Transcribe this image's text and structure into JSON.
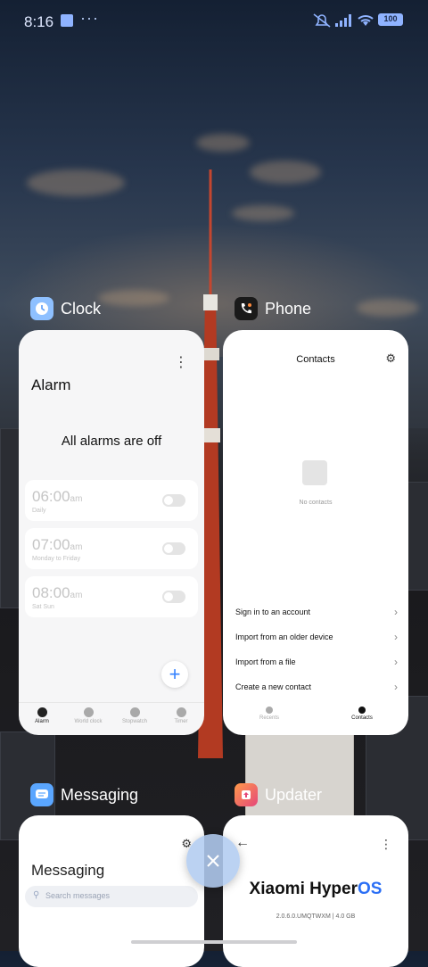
{
  "status_bar": {
    "time": "8:16",
    "battery": "100",
    "icons": [
      "app-notification-icon",
      "more-dots-icon",
      "mute-icon",
      "signal-icon",
      "wifi-icon",
      "battery-icon"
    ]
  },
  "recents": [
    {
      "app": "Clock",
      "icon": "clock-icon",
      "screen": {
        "title": "Alarm",
        "status": "All alarms are off",
        "alarms": [
          {
            "time": "06:00",
            "ampm": "am",
            "days": "Daily",
            "enabled": false
          },
          {
            "time": "07:00",
            "ampm": "am",
            "days": "Monday to Friday",
            "enabled": false
          },
          {
            "time": "08:00",
            "ampm": "am",
            "days": "Sat Sun",
            "enabled": false
          }
        ],
        "tabs": [
          "Alarm",
          "World clock",
          "Stopwatch",
          "Timer"
        ],
        "active_tab": "Alarm"
      }
    },
    {
      "app": "Phone",
      "icon": "phone-icon",
      "screen": {
        "title": "Contacts",
        "empty_text": "No contacts",
        "actions": [
          "Sign in to an account",
          "Import from an older device",
          "Import from a file",
          "Create a new contact"
        ],
        "tabs": [
          "Recents",
          "Contacts"
        ],
        "active_tab": "Contacts"
      }
    },
    {
      "app": "Messaging",
      "icon": "messaging-icon",
      "screen": {
        "title": "Messaging",
        "search_placeholder": "Search messages"
      }
    },
    {
      "app": "Updater",
      "icon": "updater-icon",
      "screen": {
        "brand_prefix": "Xiaomi Hyper",
        "brand_suffix": "OS",
        "version": "2.0.6.0.UMQTWXM | 4.0 GB"
      }
    }
  ],
  "colors": {
    "accent_blue": "#3482ff",
    "close_button": "#b2ccf0",
    "battery": "#8fb3ff"
  }
}
